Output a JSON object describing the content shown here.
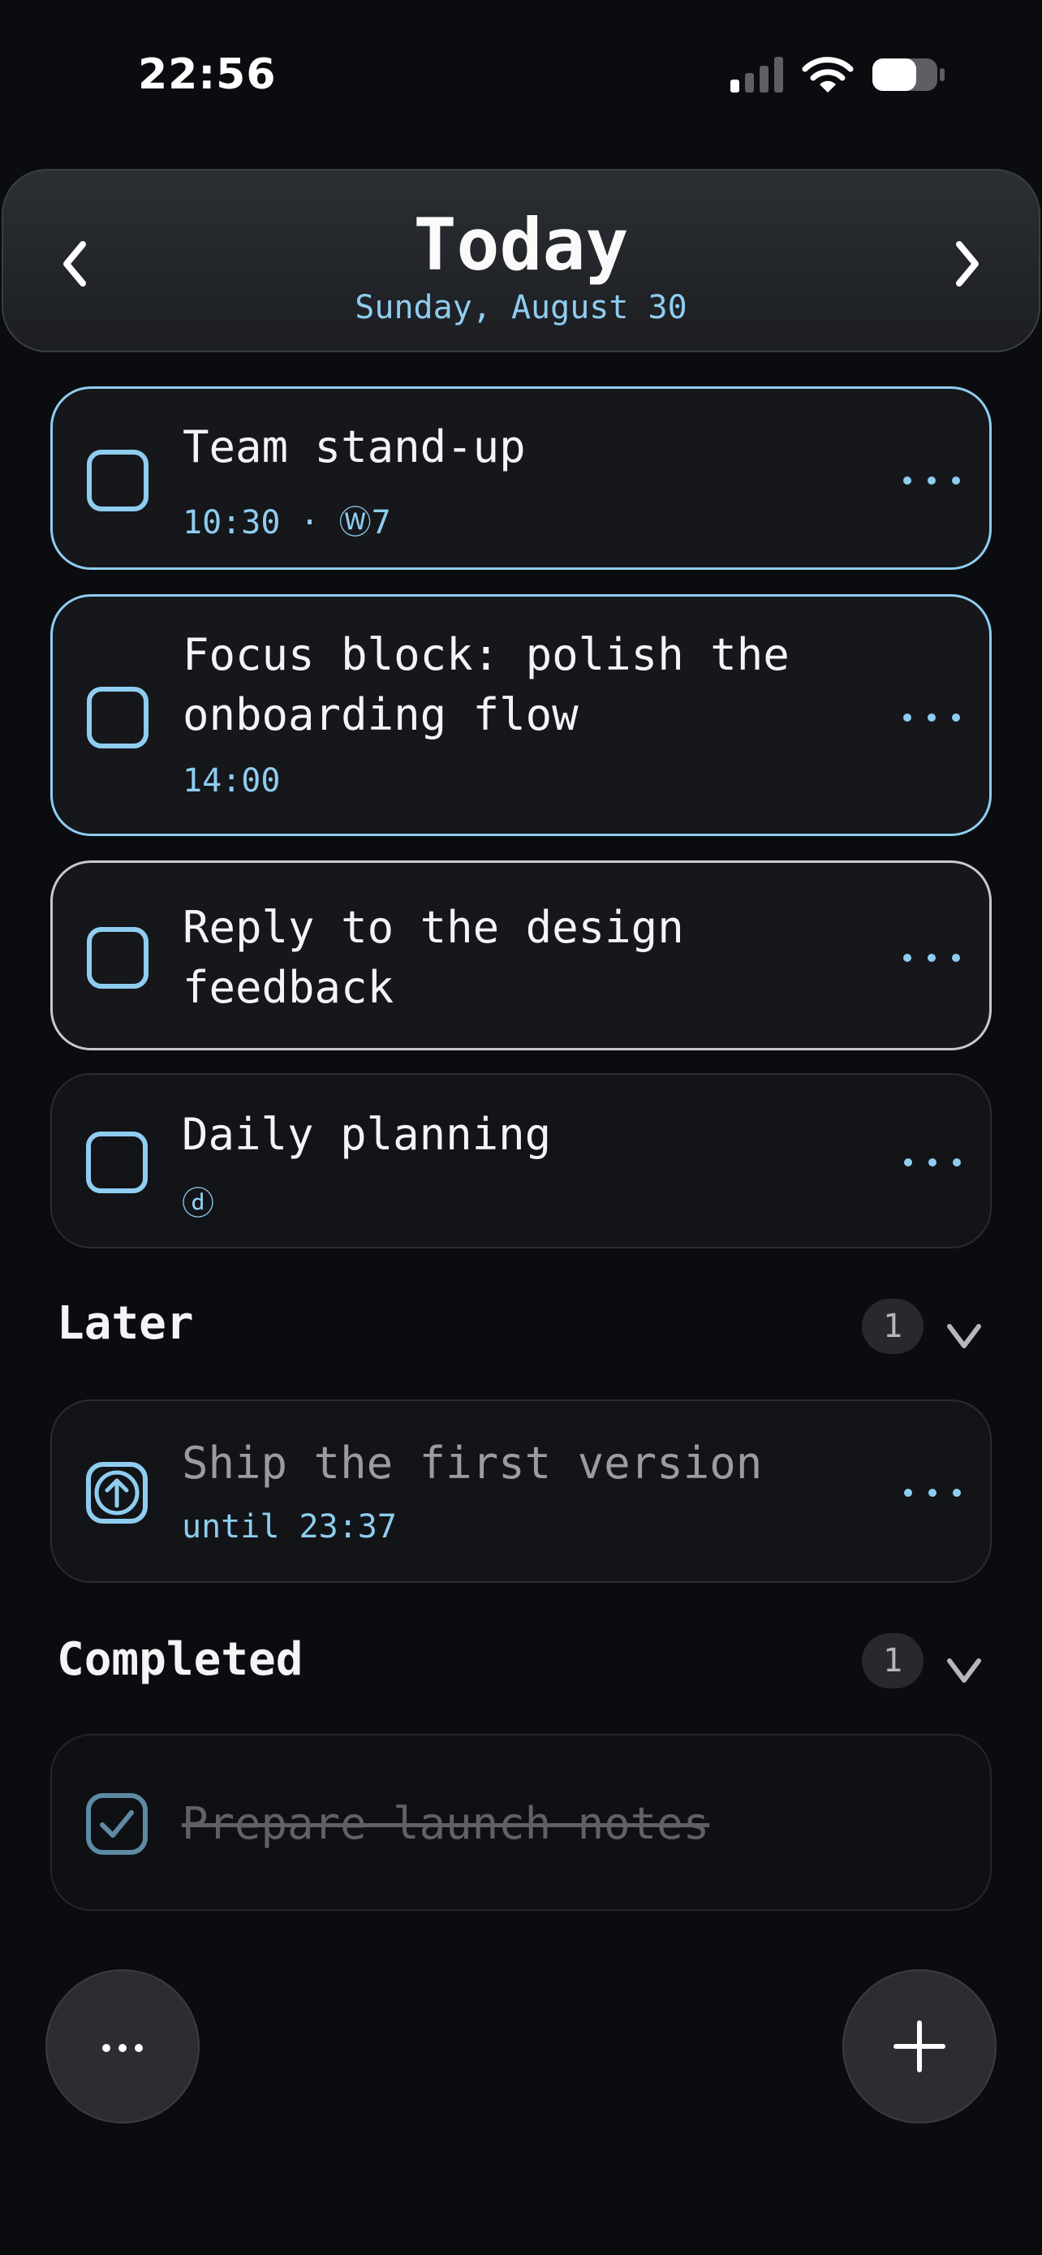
{
  "status_bar": {
    "time": "22:56"
  },
  "header": {
    "title": "Today",
    "date": "Sunday, August 30"
  },
  "tasks": [
    {
      "title": "Team stand-up",
      "meta": "10:30 · Ⓦ7"
    },
    {
      "title": "Focus block: polish the\nonboarding flow",
      "meta": "14:00"
    },
    {
      "title": "Reply to the design\nfeedback"
    },
    {
      "title": "Daily planning",
      "meta": "ⓓ"
    }
  ],
  "later": {
    "title": "Later",
    "count": "1",
    "items": [
      {
        "title": "Ship the first version",
        "meta": "until 23:37"
      }
    ]
  },
  "completed": {
    "title": "Completed",
    "count": "1",
    "items": [
      {
        "title": "Prepare launch notes"
      }
    ]
  },
  "colors": {
    "accent": "#8fcdf0",
    "background": "#0a0c0f",
    "card": "#15171b"
  },
  "icons": {
    "prev": "chevron-left-icon",
    "next": "chevron-right-icon",
    "menu": "ellipsis-icon",
    "add": "plus-icon",
    "later_task": "arrow-up-circle-icon",
    "completed_task": "checkbox-checked-icon"
  }
}
